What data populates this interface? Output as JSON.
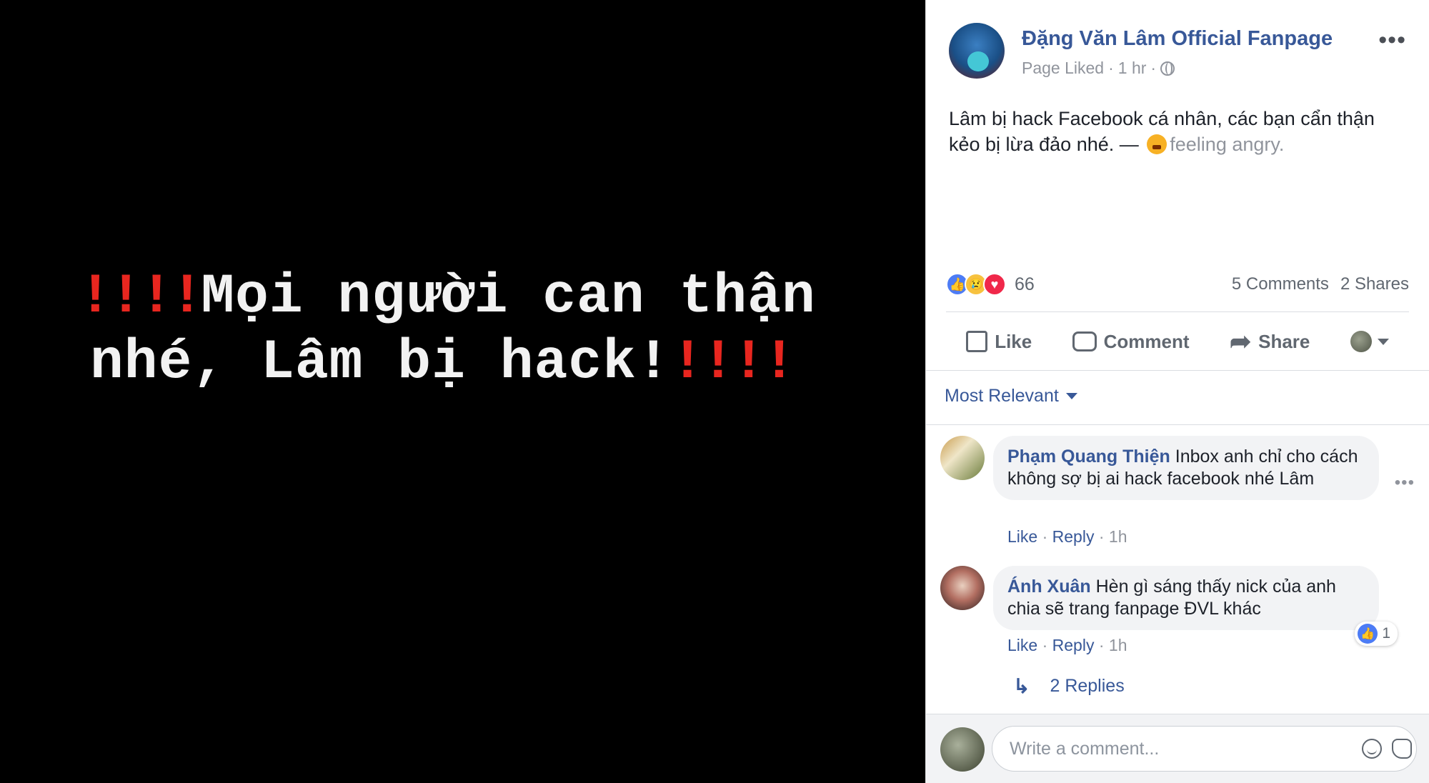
{
  "photo": {
    "line1_excl_left": "!!!!",
    "line1_text": "Mọi người can thận",
    "line2_text": "nhé, Lâm bị hack!",
    "line2_excl_right": "!!!!"
  },
  "post": {
    "page_name": "Đặng Văn Lâm Official Fanpage",
    "page_status": "Page Liked",
    "time": "1 hr",
    "more": "•••",
    "text": "Lâm bị hack Facebook cá nhân, các bạn cẩn thận kẻo bị lừa đảo nhé. —",
    "feeling": "feeling angry.",
    "reaction_count": "66",
    "comments_count": "5 Comments",
    "shares_count": "2 Shares"
  },
  "actions": {
    "like": "Like",
    "comment": "Comment",
    "share": "Share"
  },
  "sort": {
    "label": "Most Relevant"
  },
  "comments": [
    {
      "name": "Phạm Quang Thiện",
      "text": "Inbox anh chỉ cho cách không sợ bị ai hack facebook nhé Lâm",
      "like": "Like",
      "reply": "Reply",
      "time": "1h",
      "more": "•••"
    },
    {
      "name": "Ánh Xuân",
      "text": "Hèn gì sáng thấy nick của anh chia sẽ trang fanpage ĐVL khác",
      "like": "Like",
      "reply": "Reply",
      "time": "1h",
      "like_count": "1"
    }
  ],
  "replies": {
    "label": "2 Replies"
  },
  "composer": {
    "placeholder": "Write a comment..."
  },
  "colors": {
    "link": "#385898",
    "like_blue": "#4d7cf5",
    "love_red": "#f0284a",
    "alert_red": "#e8261f"
  }
}
